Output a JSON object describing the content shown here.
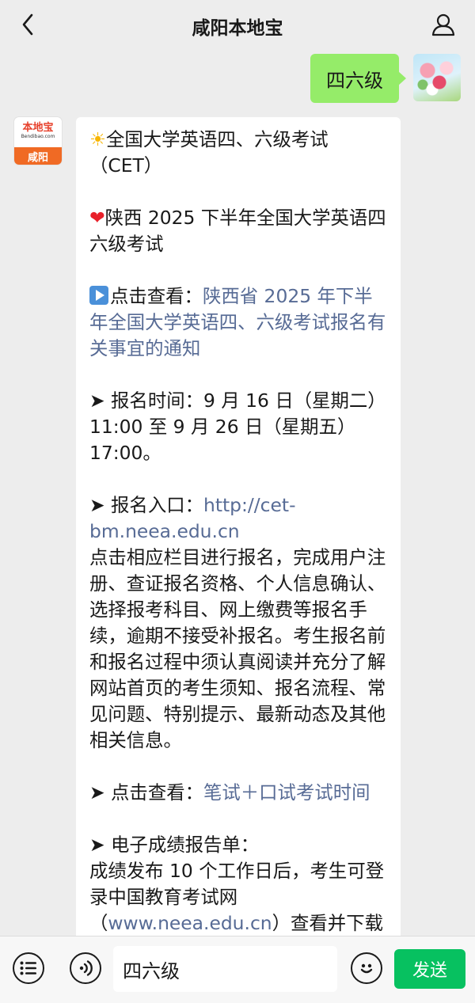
{
  "header": {
    "title": "咸阳本地宝"
  },
  "outgoing": {
    "text": "四六级"
  },
  "incoming": {
    "avatar": {
      "brand": "本地宝",
      "url": "Bendibao.com",
      "city": "咸阳"
    },
    "sun_emoji": "☀",
    "heart_emoji": "❤",
    "line_title_1": "全国大学英语四、六级考试（CET）",
    "line_title_2": "陕西 2025 下半年全国大学英语四六级考试",
    "view_prefix": "点击查看：",
    "notice_link": "陕西省 2025 年下半年全国大学英语四、六级考试报名有关事宜的通知",
    "arrow": "➤",
    "signup_time_label": " 报名时间：",
    "signup_time_value": "9 月 16 日（星期二）11:00 至 9 月 26 日（星期五）17:00。",
    "entry_label": " 报名入口：",
    "entry_link": "http://cet-bm.neea.edu.cn",
    "entry_desc": "点击相应栏目进行报名，完成用户注册、查证报名资格、个人信息确认、选择报考科目、网上缴费等报名手续，逾期不接受补报名。考生报名前和报名过程中须认真阅读并充分了解网站首页的考生须知、报名流程、常见问题、特别提示、最新动态及其他相关信息。",
    "view2_label": " 点击查看：",
    "exam_time_link": "笔试＋口试考试时间",
    "score_label": " 电子成绩报告单：",
    "score_desc_1": "成绩发布 10 个工作日后，考生可登录中国教育考试网（",
    "score_link": "www.neea.edu.cn",
    "score_desc_2": "）查看并下载电子成"
  },
  "input": {
    "value": "四六级",
    "send_label": "发送"
  }
}
